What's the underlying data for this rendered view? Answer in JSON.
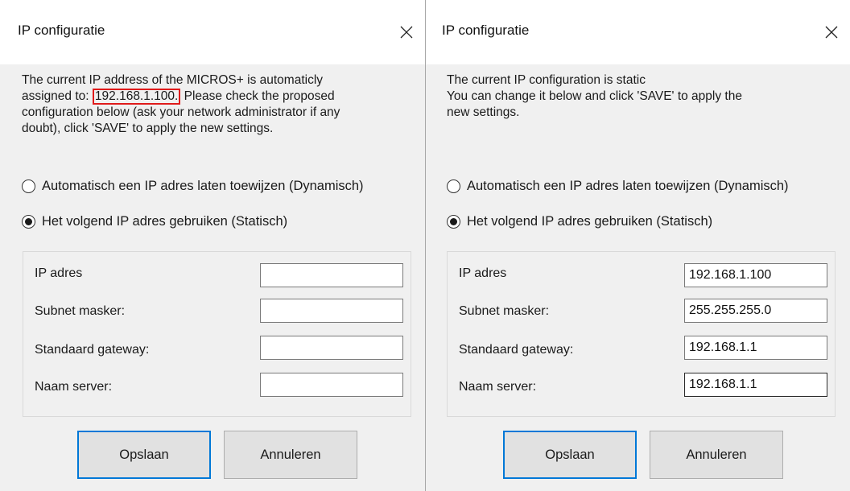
{
  "left_dialog": {
    "title": "IP configuratie",
    "info_before": "The current IP address of the MICROS+ is automaticly\nassigned to: ",
    "info_ip": "192.168.1.100.",
    "info_after": " Please check the proposed\nconfiguration below (ask your network administrator if any\ndoubt), click 'SAVE' to apply the new settings.",
    "radio_dynamic": "Automatisch een IP adres laten toewijzen (Dynamisch)",
    "radio_static": "Het volgend IP adres gebruiken (Statisch)",
    "selected_mode": "static",
    "fields": {
      "ip_label": "IP adres",
      "ip_value": "",
      "subnet_label": "Subnet masker:",
      "subnet_value": "",
      "gateway_label": "Standaard gateway:",
      "gateway_value": "",
      "dns_label": "Naam server:",
      "dns_value": ""
    },
    "save_label": "Opslaan",
    "cancel_label": "Annuleren"
  },
  "right_dialog": {
    "title": "IP configuratie",
    "info": "The current IP configuration is static\nYou can change it below and click 'SAVE' to apply the\nnew settings.",
    "radio_dynamic": "Automatisch een IP adres laten toewijzen (Dynamisch)",
    "radio_static": "Het volgend IP adres gebruiken (Statisch)",
    "selected_mode": "static",
    "fields": {
      "ip_label": "IP adres",
      "ip_value": "192.168.1.100",
      "subnet_label": "Subnet masker:",
      "subnet_value": "255.255.255.0",
      "gateway_label": "Standaard gateway:",
      "gateway_value": "192.168.1.1",
      "dns_label": "Naam server:",
      "dns_value": "192.168.1.1"
    },
    "save_label": "Opslaan",
    "cancel_label": "Annuleren"
  },
  "icons": {
    "close": "close-icon"
  },
  "colors": {
    "dialog_bg": "#f0f0f0",
    "titlebar_bg": "#ffffff",
    "highlight_box": "#e01b1b",
    "primary_button_border": "#0078d7"
  }
}
